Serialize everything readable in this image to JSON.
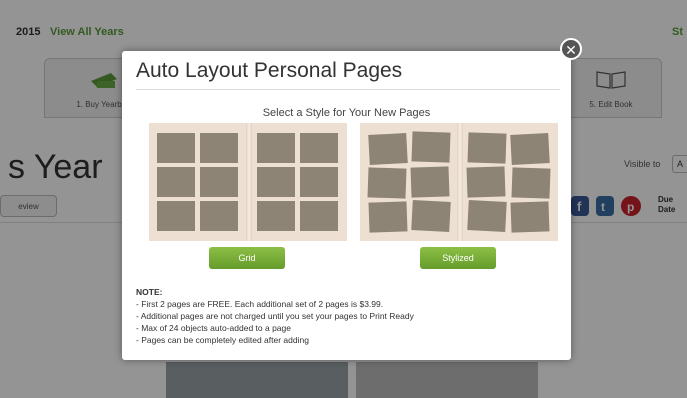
{
  "header": {
    "year": "2015",
    "view_all_years": "View All Years",
    "right_link": "St"
  },
  "steps": [
    {
      "label": "1. Buy Yearb"
    },
    {
      "label": "5. Edit Book"
    }
  ],
  "page_title": "s Year",
  "visible_to_label": "Visible to",
  "visible_to_value": "A",
  "preview_button": "eview",
  "due_date": [
    "Due",
    "Date"
  ],
  "modal": {
    "title": "Auto Layout Personal Pages",
    "subtitle": "Select a Style for Your New Pages",
    "close_icon": "close-icon",
    "grid_button": "Grid",
    "stylized_button": "Stylized",
    "note_heading": "NOTE:",
    "notes": [
      "- First 2 pages are FREE. Each additional set of 2 pages is $3.99.",
      "- Additional pages are not charged until you set your pages to Print Ready",
      "- Max of 24 objects auto-added to a page",
      "- Pages can be completely edited after adding"
    ]
  },
  "colors": {
    "accent_green": "#5a9a3a",
    "button_green": "#78ad38",
    "photo_placeholder": "#8d8475",
    "page_paper": "#ede0d2"
  }
}
